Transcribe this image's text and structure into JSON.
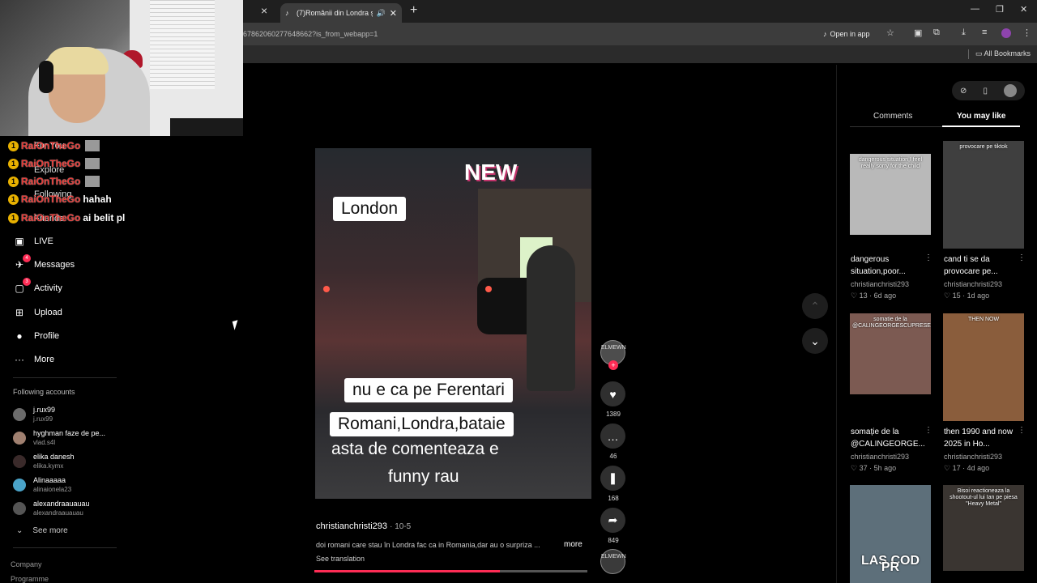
{
  "browser": {
    "prev_tab_close": "×",
    "tab_title": "(7)Românii din Londra și vi...",
    "tab_favicon": "♪",
    "tab_speaker": "🔊",
    "tab_close": "✕",
    "new_tab": "+",
    "url": "67862060277648662?is_from_webapp=1",
    "open_in_app": "Open in app",
    "all_bookmarks": "All Bookmarks",
    "window_minimize": "—",
    "window_restore": "❐",
    "window_close": "✕"
  },
  "chat": [
    {
      "badge": "1",
      "user": "RaiOnTheGo",
      "message": ""
    },
    {
      "badge": "1",
      "user": "RaiOnTheGo",
      "message": ""
    },
    {
      "badge": "1",
      "user": "RaiOnTheGo",
      "message": ""
    },
    {
      "badge": "1",
      "user": "RaiOnTheGo",
      "message": "hahah"
    },
    {
      "badge": "1",
      "user": "RaiOnTheGo",
      "message": "ai belit pl"
    }
  ],
  "sidebar": {
    "ghost_items": [
      "For You",
      "Explore",
      "Following",
      "Friends"
    ],
    "nav": [
      {
        "label": "LIVE",
        "icon": "▣",
        "badge": ""
      },
      {
        "label": "Messages",
        "icon": "✈",
        "badge": "4"
      },
      {
        "label": "Activity",
        "icon": "▢",
        "badge": "3"
      },
      {
        "label": "Upload",
        "icon": "⊞",
        "badge": ""
      },
      {
        "label": "Profile",
        "icon": "●",
        "badge": ""
      },
      {
        "label": "More",
        "icon": "···",
        "badge": ""
      }
    ],
    "following_title": "Following accounts",
    "accounts": [
      {
        "name": "j.rux99",
        "handle": "j.rux99"
      },
      {
        "name": "hyghman faze de pe...",
        "handle": "vlad.s4l"
      },
      {
        "name": "elika danesh",
        "handle": "elika.kymx"
      },
      {
        "name": "Alinaaaaa",
        "handle": "alinaionela23"
      },
      {
        "name": "alexandraauauau",
        "handle": "alexandraauauau"
      }
    ],
    "see_more": "See more",
    "footer": [
      "Company",
      "Programme"
    ]
  },
  "video": {
    "new_sticker": "NEW",
    "label_london": "London",
    "label_ferentari": "nu e ca pe Ferentari",
    "label_romani": "Romani,Londra,bataie",
    "caption_line1": "asta de comenteaza e",
    "caption_line2": "funny rau",
    "author": "christianchristi293",
    "date": "· 10-5",
    "description": "doi romani care stau în Londra fac ca in Romania,dar au o surpriza ...",
    "more": "more",
    "see_translation": "See translation",
    "progress": 0.68
  },
  "actions": {
    "avatar_text": "ELMEWN",
    "follow_plus": "+",
    "like_icon": "♥",
    "likes": "1389",
    "comment_icon": "…",
    "comments": "46",
    "save_icon": "❚",
    "saves": "168",
    "share_icon": "➦",
    "shares": "849",
    "disc_text": "ELMEWN"
  },
  "nav_arrows": {
    "up": "⌃",
    "down": "⌄"
  },
  "right_panel": {
    "tabs": [
      "Comments",
      "You may like"
    ],
    "active_tab": "You may like",
    "icons": {
      "compass": "⊘",
      "phone": "▯"
    },
    "cards": [
      {
        "thumb_text": "dangerous situation,I feel really sorry for the child",
        "title": "dangerous situation,poor...",
        "author": "christianchristi293",
        "likes": "♡ 13",
        "age": "6d ago",
        "bg": "#b9b9b9"
      },
      {
        "thumb_text": "provocare pe tiktok",
        "title": "cand ti se da provocare pe...",
        "author": "christianchristi293",
        "likes": "♡ 15",
        "age": "1d ago",
        "bg": "#3f3f3f"
      },
      {
        "thumb_text": "somatie de la @CALINGEORGESCUPRESEDINTE",
        "title": "somație de la @CALINGEORGE...",
        "author": "christianchristi293",
        "likes": "♡ 37",
        "age": "5h ago",
        "bg": "#7c5a52"
      },
      {
        "thumb_text": "THEN  NOW",
        "title": "then 1990 and now 2025 in Ho...",
        "author": "christianchristi293",
        "likes": "♡ 17",
        "age": "4d ago",
        "bg": "#8a5d3c"
      },
      {
        "thumb_text": "LAS  COD PR",
        "title": "",
        "author": "",
        "likes": "",
        "age": "",
        "bg": "#5d6f7a"
      },
      {
        "thumb_text": "Bisoi reactioneaza la shootout-ul lui Ian pe piesa \"Heavy Metal\"",
        "title": "",
        "author": "",
        "likes": "",
        "age": "",
        "bg": "#3a3531"
      }
    ]
  },
  "colors": {
    "accent": "#fe2c55",
    "background": "#000000",
    "chat_name": "#e53935"
  }
}
